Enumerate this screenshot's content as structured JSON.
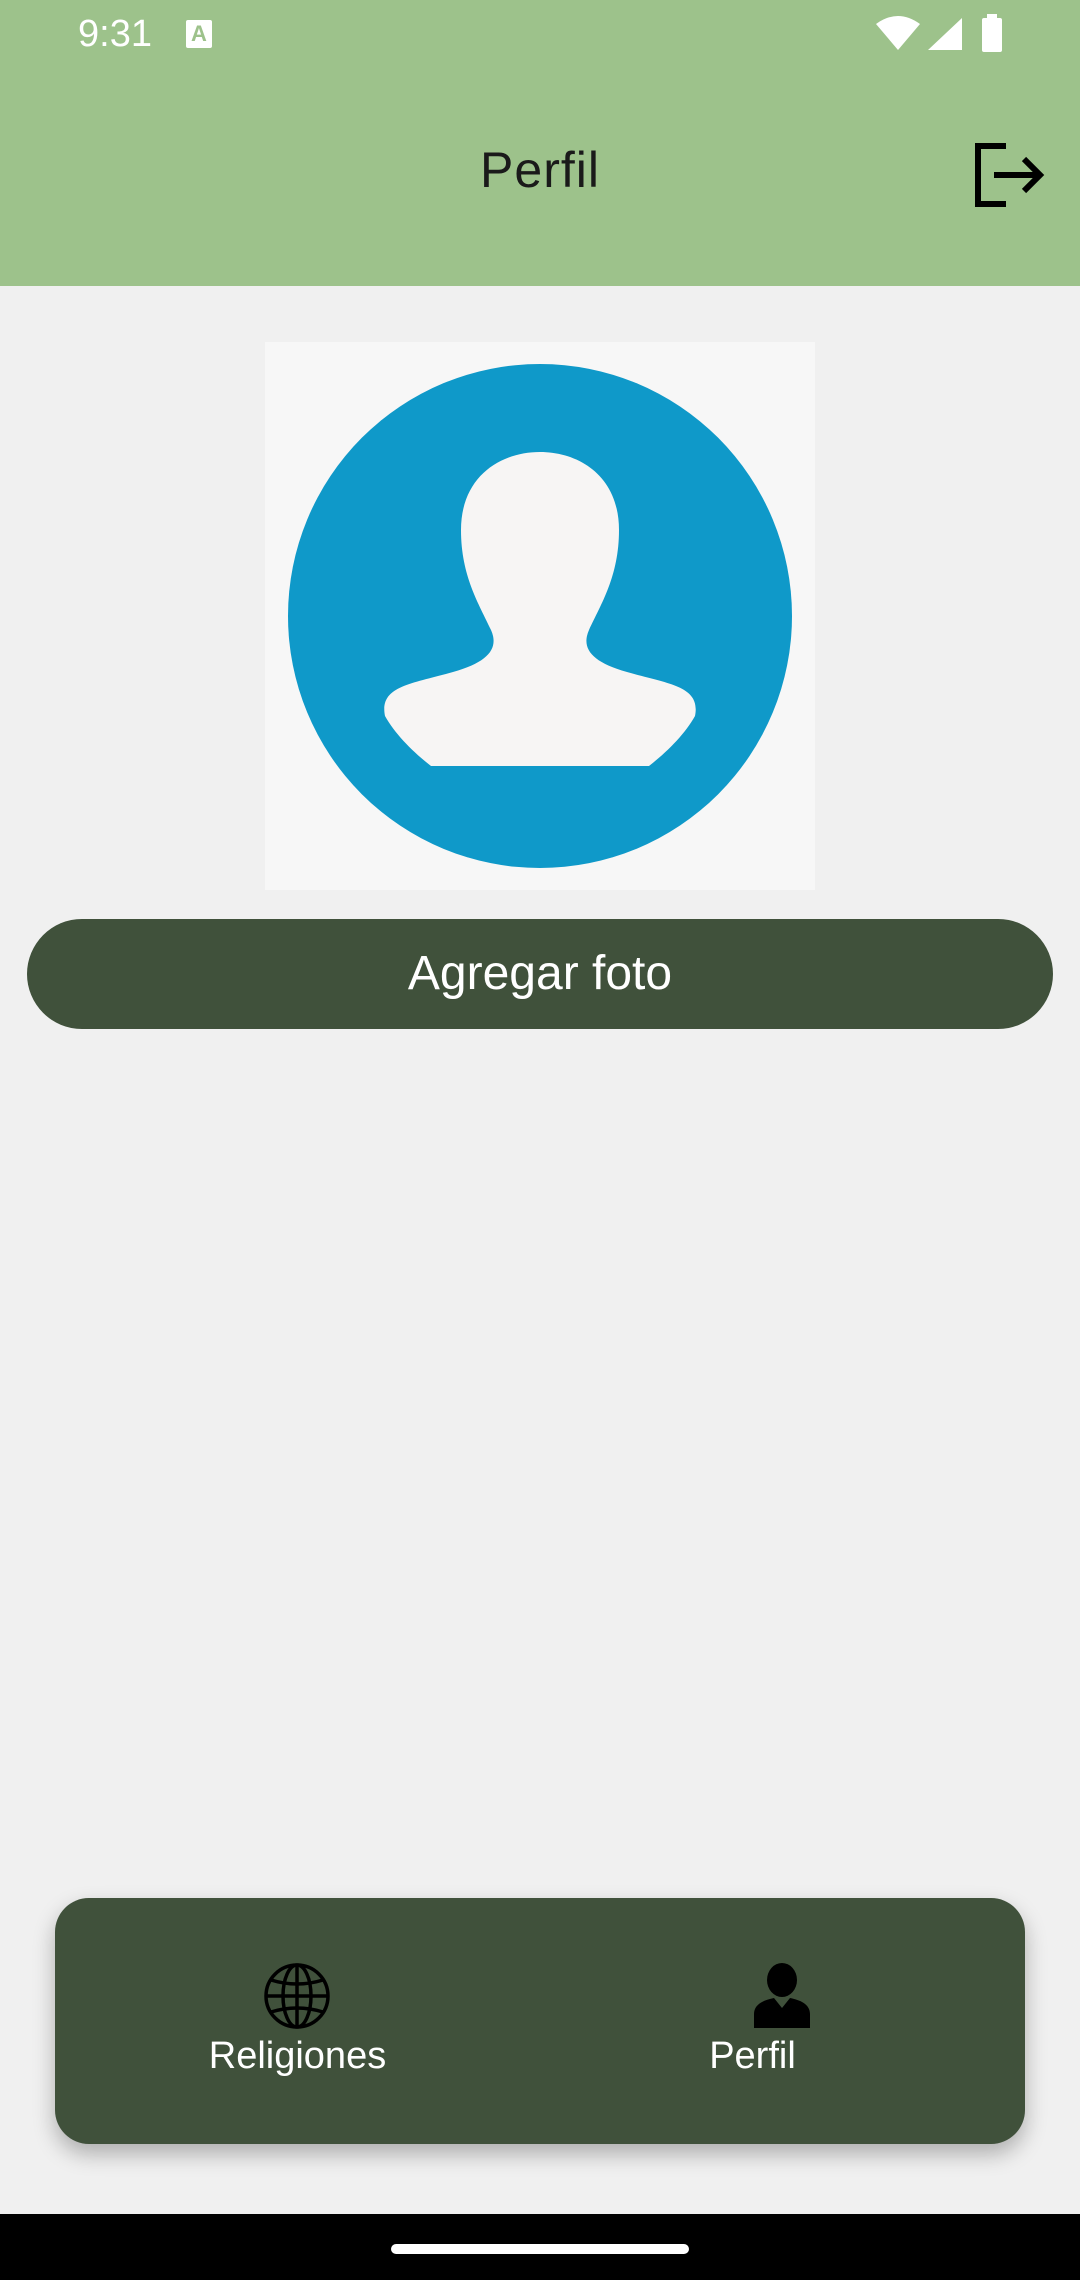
{
  "status_bar": {
    "time": "9:31",
    "notification_icon": "a-icon",
    "wifi_icon": "wifi-icon",
    "signal_icon": "signal-icon",
    "battery_icon": "battery-icon"
  },
  "app_bar": {
    "title": "Perfil",
    "logout_icon": "logout-icon"
  },
  "profile": {
    "avatar_icon": "user-avatar-icon",
    "add_photo_label": "Agregar foto"
  },
  "bottom_nav": {
    "items": [
      {
        "label": "Religiones",
        "icon": "globe-icon",
        "selected": false
      },
      {
        "label": "Perfil",
        "icon": "user-icon",
        "selected": true
      }
    ]
  },
  "colors": {
    "app_bar": "#9dc28b",
    "background": "#f0f0f0",
    "button": "#40513b",
    "avatar_blue": "#0f99c9",
    "avatar_silhouette": "#f7f5f4"
  }
}
